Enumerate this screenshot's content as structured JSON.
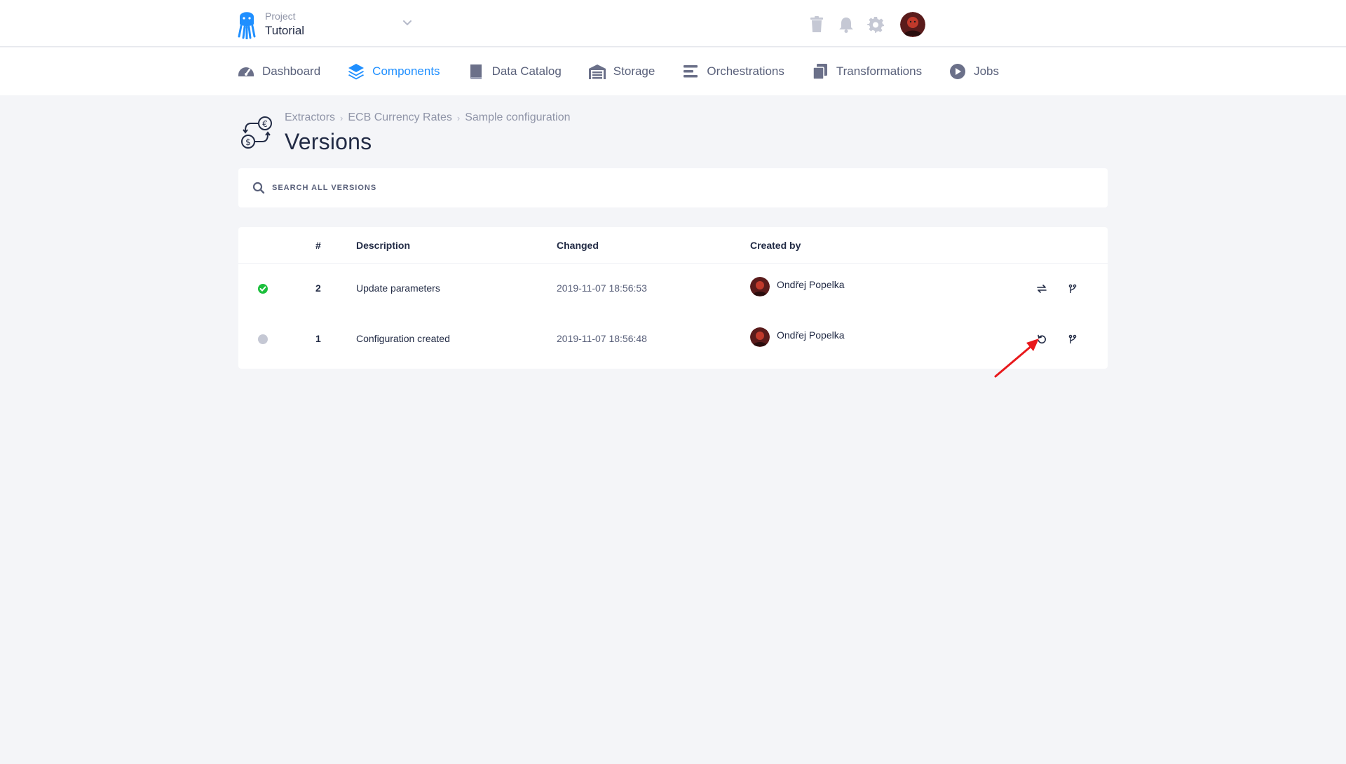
{
  "project": {
    "label": "Project",
    "name": "Tutorial"
  },
  "topbar_icons": [
    "trash-icon",
    "bell-icon",
    "gear-icon",
    "user-avatar"
  ],
  "nav": {
    "items": [
      {
        "label": "Dashboard",
        "icon": "gauge-icon",
        "active": false
      },
      {
        "label": "Components",
        "icon": "layers-icon",
        "active": true
      },
      {
        "label": "Data Catalog",
        "icon": "book-icon",
        "active": false
      },
      {
        "label": "Storage",
        "icon": "warehouse-icon",
        "active": false
      },
      {
        "label": "Orchestrations",
        "icon": "bars-icon",
        "active": false
      },
      {
        "label": "Transformations",
        "icon": "copy-icon",
        "active": false
      },
      {
        "label": "Jobs",
        "icon": "play-circle-icon",
        "active": false
      }
    ]
  },
  "breadcrumb": [
    "Extractors",
    "ECB Currency Rates",
    "Sample configuration"
  ],
  "page": {
    "title": "Versions"
  },
  "search": {
    "placeholder": "SEARCH ALL VERSIONS",
    "value": ""
  },
  "table": {
    "headers": {
      "num": "#",
      "description": "Description",
      "changed": "Changed",
      "created_by": "Created by"
    },
    "rows": [
      {
        "status": "active",
        "num": "2",
        "description": "Update parameters",
        "changed": "2019-11-07 18:56:53",
        "created_by": "Ondřej Popelka",
        "actions": [
          "compare-icon",
          "branch-icon"
        ]
      },
      {
        "status": "inactive",
        "num": "1",
        "description": "Configuration created",
        "changed": "2019-11-07 18:56:48",
        "created_by": "Ondřej Popelka",
        "actions": [
          "restore-icon",
          "branch-icon"
        ]
      }
    ]
  },
  "colors": {
    "accent": "#1f8fff",
    "active_status": "#1bbf3c",
    "inactive_status": "#c5c8d4",
    "annotation": "#e8191c"
  }
}
